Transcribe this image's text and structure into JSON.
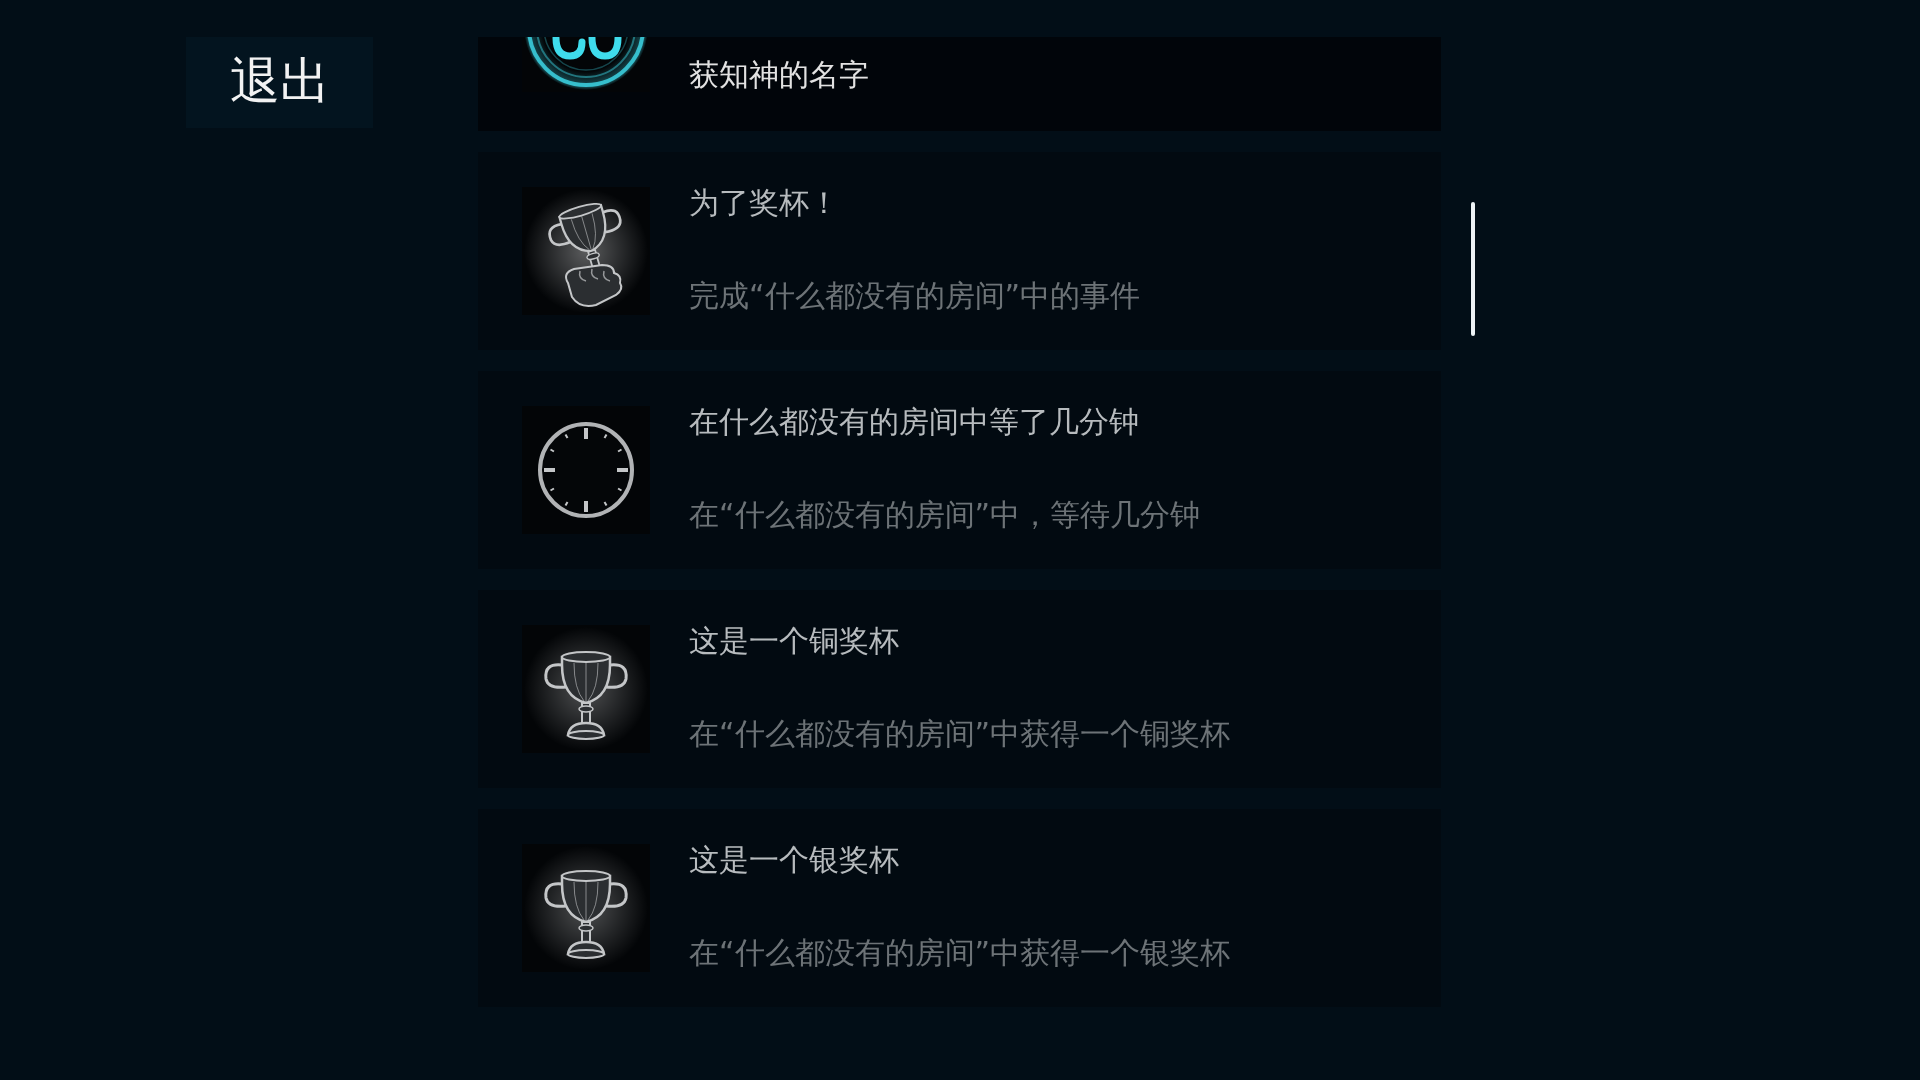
{
  "exit_button": {
    "label": "退出"
  },
  "achievements": [
    {
      "kind": "badge",
      "unlocked": true,
      "description": "获知神的名字"
    },
    {
      "kind": "raised",
      "unlocked": false,
      "title": "为了奖杯！",
      "description": "完成“什么都没有的房间”中的事件"
    },
    {
      "kind": "clock",
      "unlocked": false,
      "title": "在什么都没有的房间中等了几分钟",
      "description": "在“什么都没有的房间”中，等待几分钟"
    },
    {
      "kind": "trophy",
      "unlocked": false,
      "title": "这是一个铜奖杯",
      "description": "在“什么都没有的房间”中获得一个铜奖杯"
    },
    {
      "kind": "trophy",
      "unlocked": false,
      "title": "这是一个银奖杯",
      "description": "在“什么都没有的房间”中获得一个银奖杯"
    }
  ]
}
